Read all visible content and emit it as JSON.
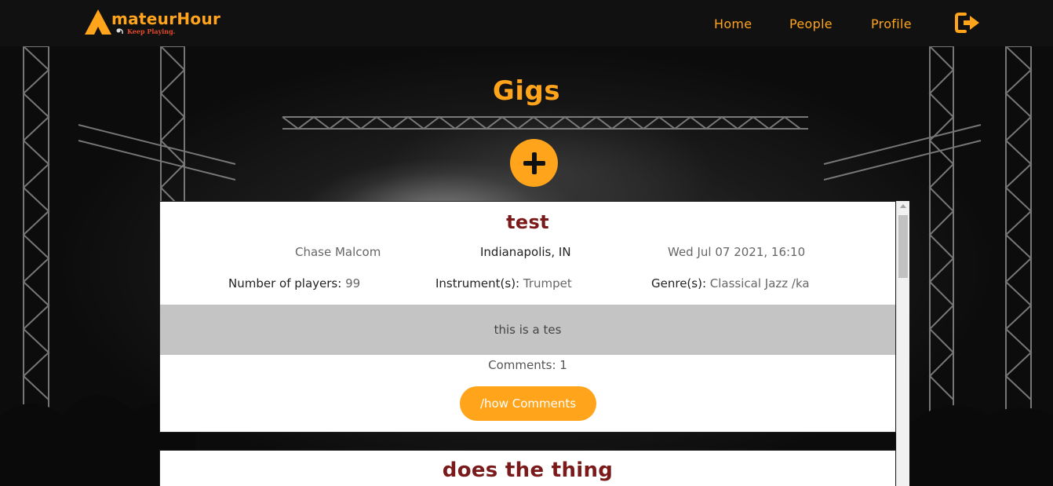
{
  "brand": {
    "name": "AmateurHour",
    "name_rest": "mateurHour",
    "tagline": "Keep Playing."
  },
  "nav": {
    "home": "Home",
    "people": "People",
    "profile": "Profile"
  },
  "icons": {
    "logout": "logout-icon",
    "add": "plus-icon",
    "logo": "tent-logo-icon"
  },
  "colors": {
    "accent": "#ffa41b",
    "title": "#7a1a1a",
    "topbar": "#111111"
  },
  "page": {
    "title": "Gigs"
  },
  "gigs": [
    {
      "title": "test",
      "author": "Chase Malcom",
      "location": "Indianapolis, IN",
      "date": "Wed Jul 07 2021, 16:10",
      "players_label": "Number of players:",
      "players_value": "99",
      "instruments_label": "Instrument(s):",
      "instruments_value": "Trumpet",
      "genres_label": "Genre(s):",
      "genres_value": "Classical Jazz /ka",
      "description": "this is a tes",
      "comments": "Comments: 1",
      "show_comments": "/how Comments"
    },
    {
      "title": "does the thing"
    }
  ]
}
